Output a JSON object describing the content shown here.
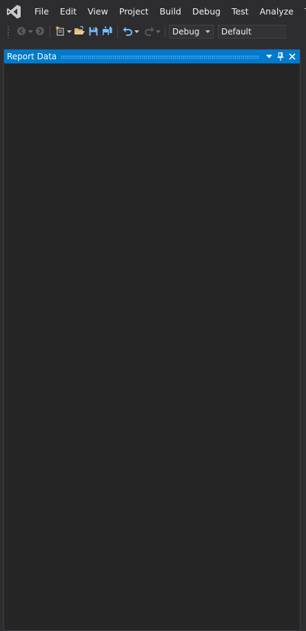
{
  "menu": {
    "items": [
      "File",
      "Edit",
      "View",
      "Project",
      "Build",
      "Debug",
      "Test",
      "Analyze",
      "Too"
    ]
  },
  "toolbar": {
    "configuration": "Debug",
    "platform": "Default",
    "icons": [
      "back-icon",
      "forward-icon",
      "new-project-icon",
      "open-file-icon",
      "save-icon",
      "save-all-icon",
      "undo-icon",
      "redo-icon"
    ]
  },
  "tool_window": {
    "title": "Report Data"
  },
  "colors": {
    "background": "#2d2d30",
    "panel": "#252526",
    "accent": "#007acc",
    "text": "#f1f1f1",
    "save_icon": "#75beff",
    "open_icon": "#dcb67a"
  }
}
